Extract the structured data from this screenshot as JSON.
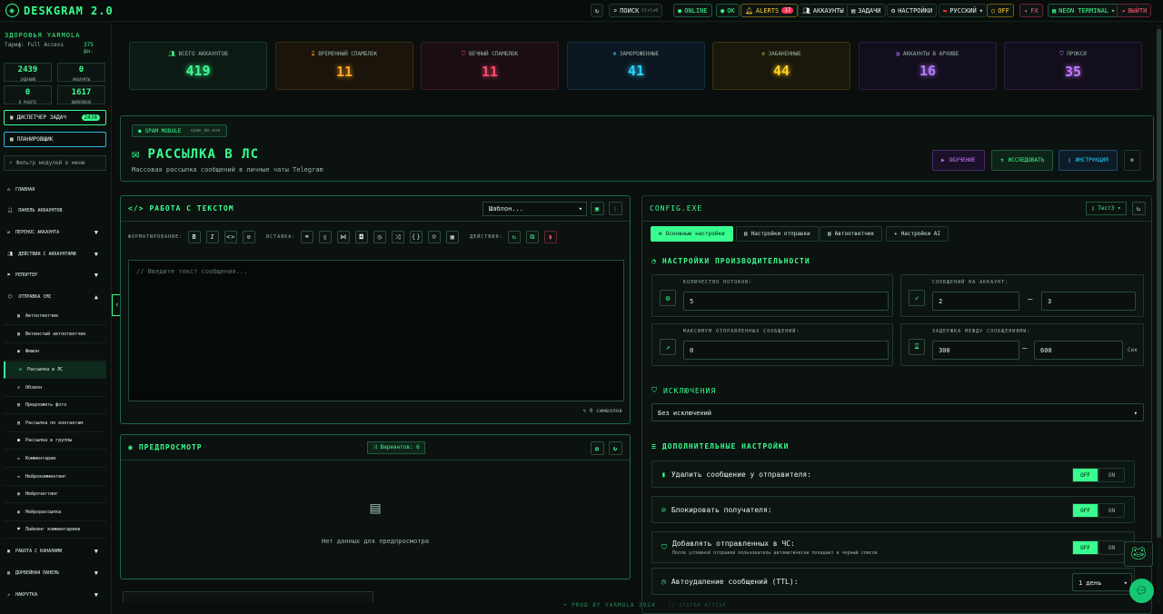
{
  "app": {
    "title": "DESKGRAM 2.0"
  },
  "topbar": {
    "search_label": "ПОИСК",
    "search_shortcut": "Ctrl+K",
    "online": "ONLINE",
    "ok": "OK",
    "alerts": "ALERTS",
    "alerts_count": "17",
    "accounts": "АККАУНТЫ",
    "tasks": "ЗАДАЧИ",
    "settings": "НАСТРОЙКИ",
    "language": "РУССКИЙ",
    "off": "OFF",
    "fx": "FX",
    "theme": "NEON TERMINAL",
    "logout": "ВЫЙТИ"
  },
  "sidebar": {
    "greeting": "ЗДОРОВЬЯ YARMOLA",
    "tarif": "Тариф: Full Access",
    "days": "375 дн.",
    "stats": [
      {
        "value": "2439",
        "label": "ЗАДАНИЙ"
      },
      {
        "value": "0",
        "label": "АККАУНТЫ"
      },
      {
        "value": "0",
        "label": "В РАБОТЕ"
      },
      {
        "value": "1617",
        "label": "ВЫПОЛНЕНО"
      }
    ],
    "dispatcher": "ДИСПЕТЧЕР ЗАДАЧ",
    "dispatcher_count": "2438",
    "scheduler": "ПЛАНИРОВЩИК",
    "filter_placeholder": "Фильтр модулей в меню",
    "nav": [
      "ГЛАВНАЯ",
      "ПАНЕЛЬ АККАУНТОВ",
      "ПЕРЕНОС АККАУНТА",
      "ДЕЙСТВИЯ С АККАУНТАМИ",
      "РЕПОРТЕР",
      "ОТПРАВКА СМС"
    ],
    "subnav": [
      "Автоответчик",
      "Ветвистый автоответчик",
      "Фишон",
      "Рассылка в ЛС",
      "Обзвон",
      "Предложить фото",
      "Рассылка по контактам",
      "Рассылка в группы",
      "Комментарии",
      "Нейрокомментинг",
      "Нейрочаттинг",
      "Нейрорассылка",
      "Лайкинг комментариев"
    ],
    "nav_bottom": [
      "РАБОТА С КАНАЛАМИ",
      "ДОРВЕЙНАЯ ПАНЕЛЬ",
      "НАКРУТКА"
    ]
  },
  "stats_cards": [
    {
      "title": "ВСЕГО АККАУНТОВ",
      "value": "419",
      "color": "#39ff8f"
    },
    {
      "title": "ВРЕМЕННЫЙ СПАМБЛОК",
      "value": "11",
      "color": "#ffa726"
    },
    {
      "title": "ВЕЧНЫЙ СПАМБЛОК",
      "value": "11",
      "color": "#ff4d6d"
    },
    {
      "title": "ЗАМОРОЖЕННЫЕ",
      "value": "41",
      "color": "#29d4ff"
    },
    {
      "title": "ЗАБАНЕННЫЕ",
      "value": "44",
      "color": "#ffd21f"
    },
    {
      "title": "АККАУНТЫ В АРХИВЕ",
      "value": "16",
      "color": "#b57cff"
    },
    {
      "title": "ПРОКСИ",
      "value": "35",
      "color": "#c47bff"
    }
  ],
  "hero": {
    "chip": "SPAM MODULE",
    "chip_id": "spam_dm.exe",
    "title": "РАССЫЛКА В ЛС",
    "subtitle": "Массовая рассылка сообщений в личные чаты Telegram",
    "btn_learn": "ОБУЧЕНИЕ",
    "btn_research": "ИССЛЕДОВАТЬ",
    "btn_guide": "ИНСТРУКЦИЯ"
  },
  "editor": {
    "title": "РАБОТА С ТЕКСТОМ",
    "template_value": "Шаблон...",
    "format_label": "ФОРМАТИРОВАНИЕ:",
    "insert_label": "ВСТАВКА:",
    "actions_label": "ДЕЙСТВИЯ:",
    "placeholder": "// Введите текст сообщения...",
    "chars": "0 символов"
  },
  "preview": {
    "title": "ПРЕДПРОСМОТР",
    "variants": "Вариантов: 6",
    "empty": "Нет данных для предпросмотра"
  },
  "config": {
    "title": "CONFIG.EXE",
    "profile": "Тест3",
    "tabs": [
      "Основные настройки",
      "Настройки отправки",
      "Автоответчик",
      "Настройки AI"
    ],
    "perf_title": "НАСТРОЙКИ ПРОИЗВОДИТЕЛЬНОСТИ",
    "threads_label": "КОЛИЧЕСТВО ПОТОКОВ:",
    "threads": "5",
    "per_account_label": "СООБЩЕНИЙ НА АККАУНТ:",
    "per_account_min": "2",
    "per_account_max": "3",
    "max_sent_label": "МАКСИМУМ ОТПРАВЛЕННЫХ СООБЩЕНИЙ:",
    "max_sent": "0",
    "delay_label": "ЗАДЕРЖКА МЕЖДУ СООБЩЕНИЯМИ:",
    "delay_min": "300",
    "delay_max": "600",
    "delay_unit": "Сек",
    "excl_title": "ИСКЛЮЧЕНИЯ",
    "excl_value": "Без исключений",
    "extra_title": "ДОПОЛНИТЕЛЬНЫЕ НАСТРОЙКИ",
    "opt_delete": "Удалить сообщение у отправителя:",
    "opt_block": "Блокировать получателя:",
    "opt_blacklist": "Добавлять отправленных в ЧС:",
    "opt_blacklist_hint": "После успешной отправки пользователь автоматически попадает в черный список",
    "opt_ttl": "Автоудаление сообщений (TTL):",
    "ttl_value": "1 день",
    "off": "OFF",
    "on": "ON"
  },
  "footer": {
    "prod": "PROD BY YARMOLA 2024",
    "status": "// SYSTEM ACTIVE"
  }
}
